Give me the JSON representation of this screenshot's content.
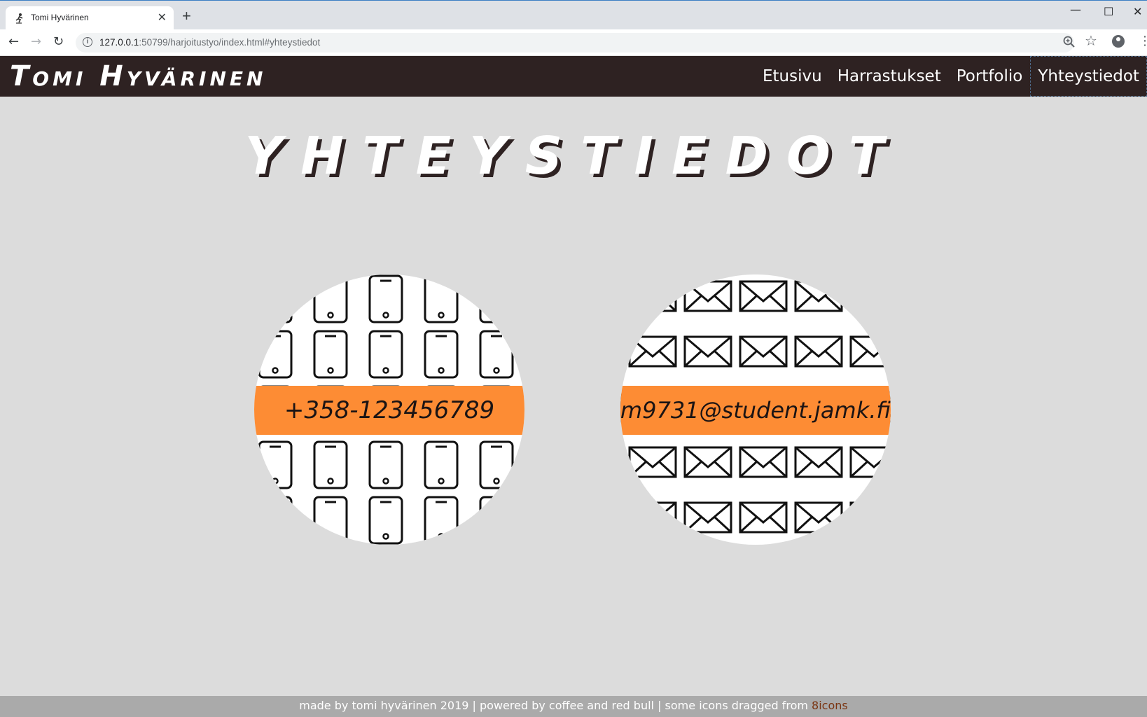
{
  "browser": {
    "tab_title": "Tomi Hyvärinen",
    "tab_close": "✕",
    "new_tab": "+",
    "url_host": "127.0.0.1",
    "url_rest": ":50799/harjoitustyo/index.html#yhteystiedot",
    "window_controls": {
      "minimize": "—",
      "maximize": "☐",
      "close": "✕"
    },
    "icons": [
      "back-arrow-icon",
      "forward-arrow-icon",
      "reload-icon",
      "info-icon",
      "zoom-icon",
      "star-icon",
      "profile-icon",
      "menu-icon"
    ]
  },
  "header": {
    "logo": "Tomi Hyvärinen",
    "nav": [
      {
        "label": "Etusivu",
        "active": false
      },
      {
        "label": "Harrastukset",
        "active": false
      },
      {
        "label": "Portfolio",
        "active": false
      },
      {
        "label": "Yhteystiedot",
        "active": true
      }
    ]
  },
  "main": {
    "title": "Yhteystiedot",
    "contacts": [
      {
        "type": "phone",
        "value": "+358-123456789"
      },
      {
        "type": "email",
        "value": "m9731@student.jamk.fi"
      }
    ]
  },
  "footer": {
    "text": "made by tomi hyvärinen 2019 | powered by coffee and red bull | some icons dragged from ",
    "link": "8icons"
  },
  "colors": {
    "header_bg": "#2e2222",
    "page_bg": "#dcdcdc",
    "accent_band": "#fd8c34",
    "footer_bg": "#aaaaaa",
    "footer_link": "#7a3512"
  }
}
